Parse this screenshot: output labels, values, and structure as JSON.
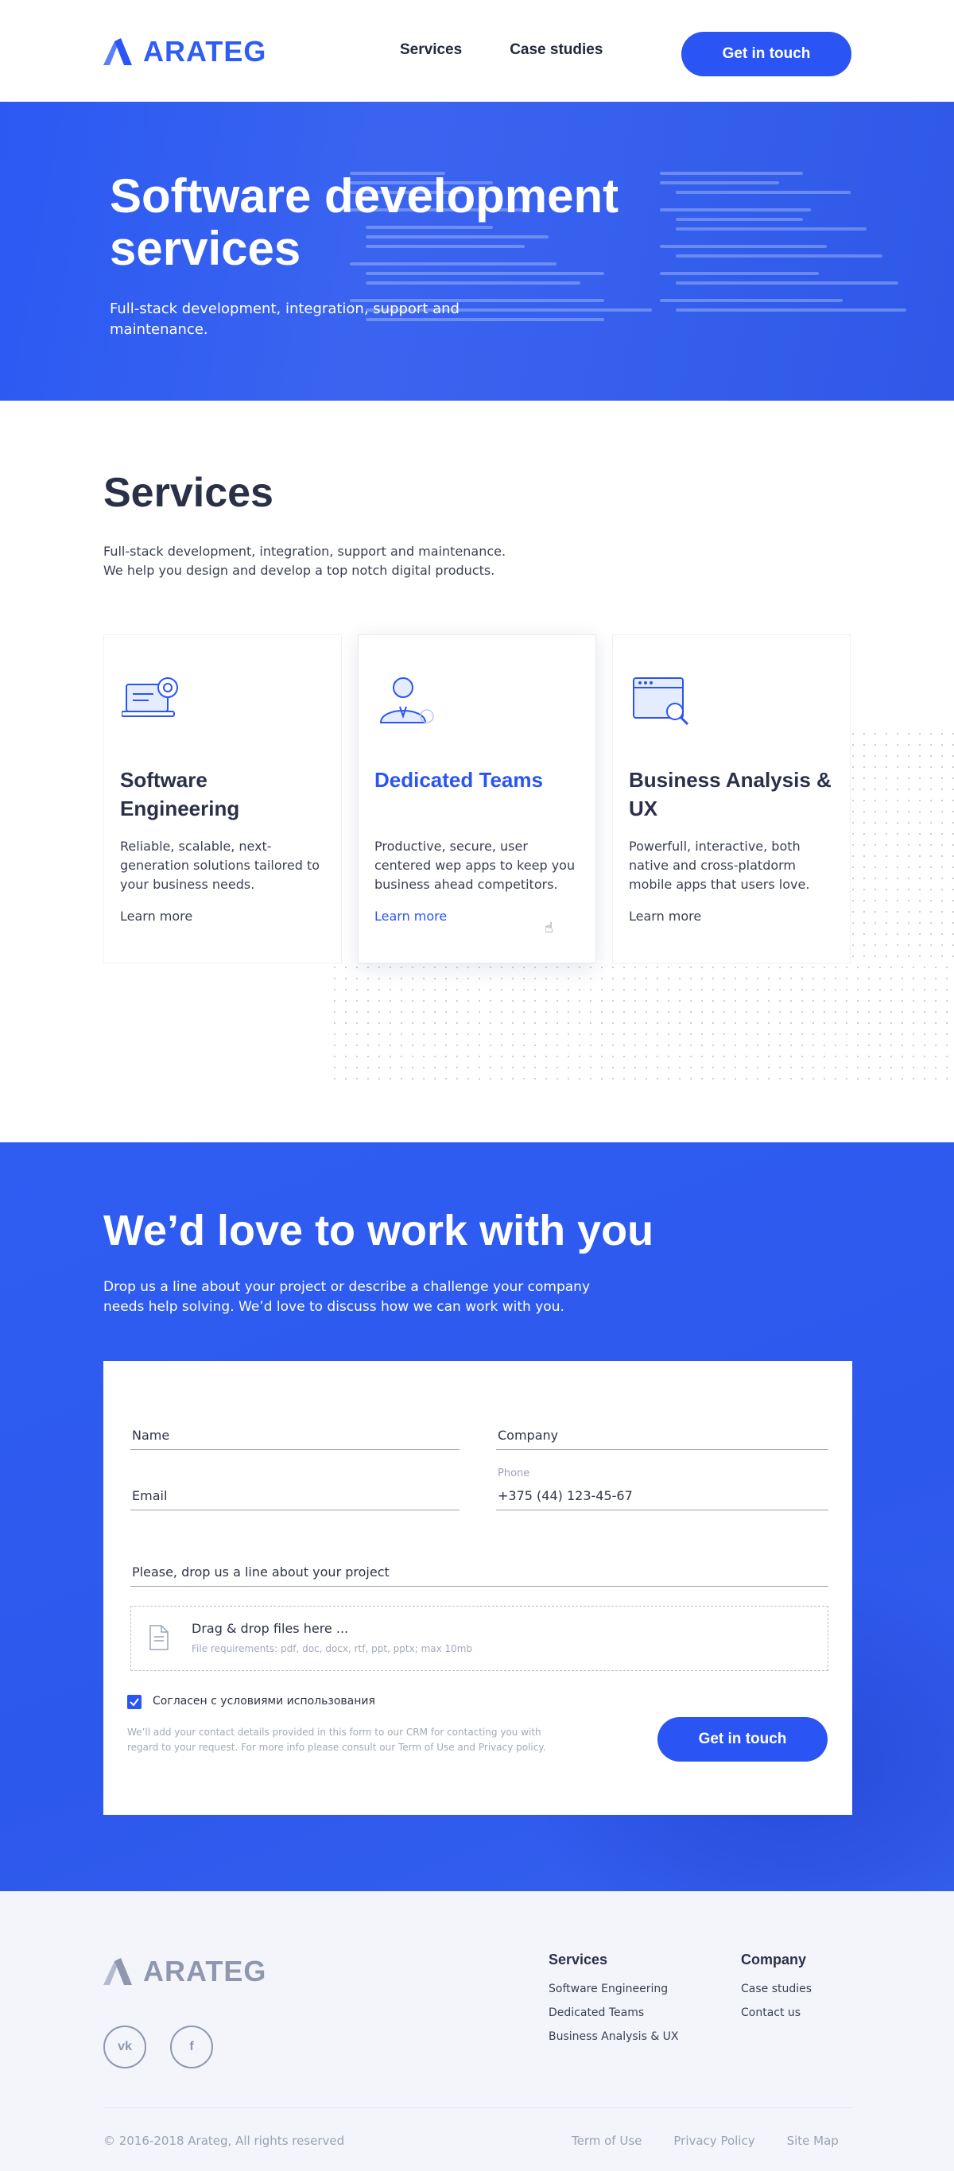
{
  "brand": {
    "name": "ARATEG",
    "accent": "#2a55f4",
    "footer_color": "#8e97ae"
  },
  "header": {
    "nav": [
      "Services",
      "Case studies"
    ],
    "cta": "Get in touch"
  },
  "hero": {
    "title_line1": "Software development",
    "title_line2": "services",
    "subtitle": "Full-stack development, integration, support and maintenance."
  },
  "services": {
    "title": "Services",
    "desc_line1": "Full-stack development, integration, support and maintenance.",
    "desc_line2": "We help you design and develop a top notch digital products.",
    "cards": [
      {
        "title": "Software Engineering",
        "text": "Reliable, scalable, next-generation solutions tailored to your business needs.",
        "link": "Learn more",
        "icon": "laptop-gear-icon"
      },
      {
        "title": "Dedicated Teams",
        "text": "Productive, secure, user centered wep apps to keep you business ahead competitors.",
        "link": "Learn more",
        "icon": "team-person-icon"
      },
      {
        "title": "Business Analysis & UX",
        "text": "Powerfull, interactive, both native and cross-platdorm mobile apps that users love.",
        "link": "Learn more",
        "icon": "browser-search-icon"
      }
    ]
  },
  "contact": {
    "title": "We’d love to work with you",
    "subtitle": "Drop us a line about your project or describe a challenge your company needs help solving. We’d love to discuss how we can work with you.",
    "form": {
      "name_placeholder": "Name",
      "company_placeholder": "Company",
      "email_placeholder": "Email",
      "phone_label": "Phone",
      "phone_value": "+375 (44) 123-45-67",
      "message_placeholder": "Please, drop us a line about your project",
      "drop_title": "Drag & drop files here ...",
      "drop_requirements": "File requirements: pdf, doc, docx, rtf, ppt, pptx; max 10mb",
      "consent_label": "Согласен с условиями использования",
      "consent_checked": true,
      "legal": "We’ll add your contact details provided in this form to our CRM for contacting you with regard to your request. For more info please consult our Term of Use and Privacy policy.",
      "submit": "Get in touch"
    }
  },
  "footer": {
    "social": [
      "vk",
      "f"
    ],
    "col_services": {
      "heading": "Services",
      "links": [
        "Software Engineering",
        "Dedicated Teams",
        "Business Analysis & UX"
      ]
    },
    "col_company": {
      "heading": "Company",
      "links": [
        "Case studies",
        "Contact us"
      ]
    },
    "copyright": "© 2016-2018 Arateg, All rights reserved",
    "bottom_links": [
      "Term of Use",
      "Privacy Policy",
      "Site Map"
    ]
  }
}
